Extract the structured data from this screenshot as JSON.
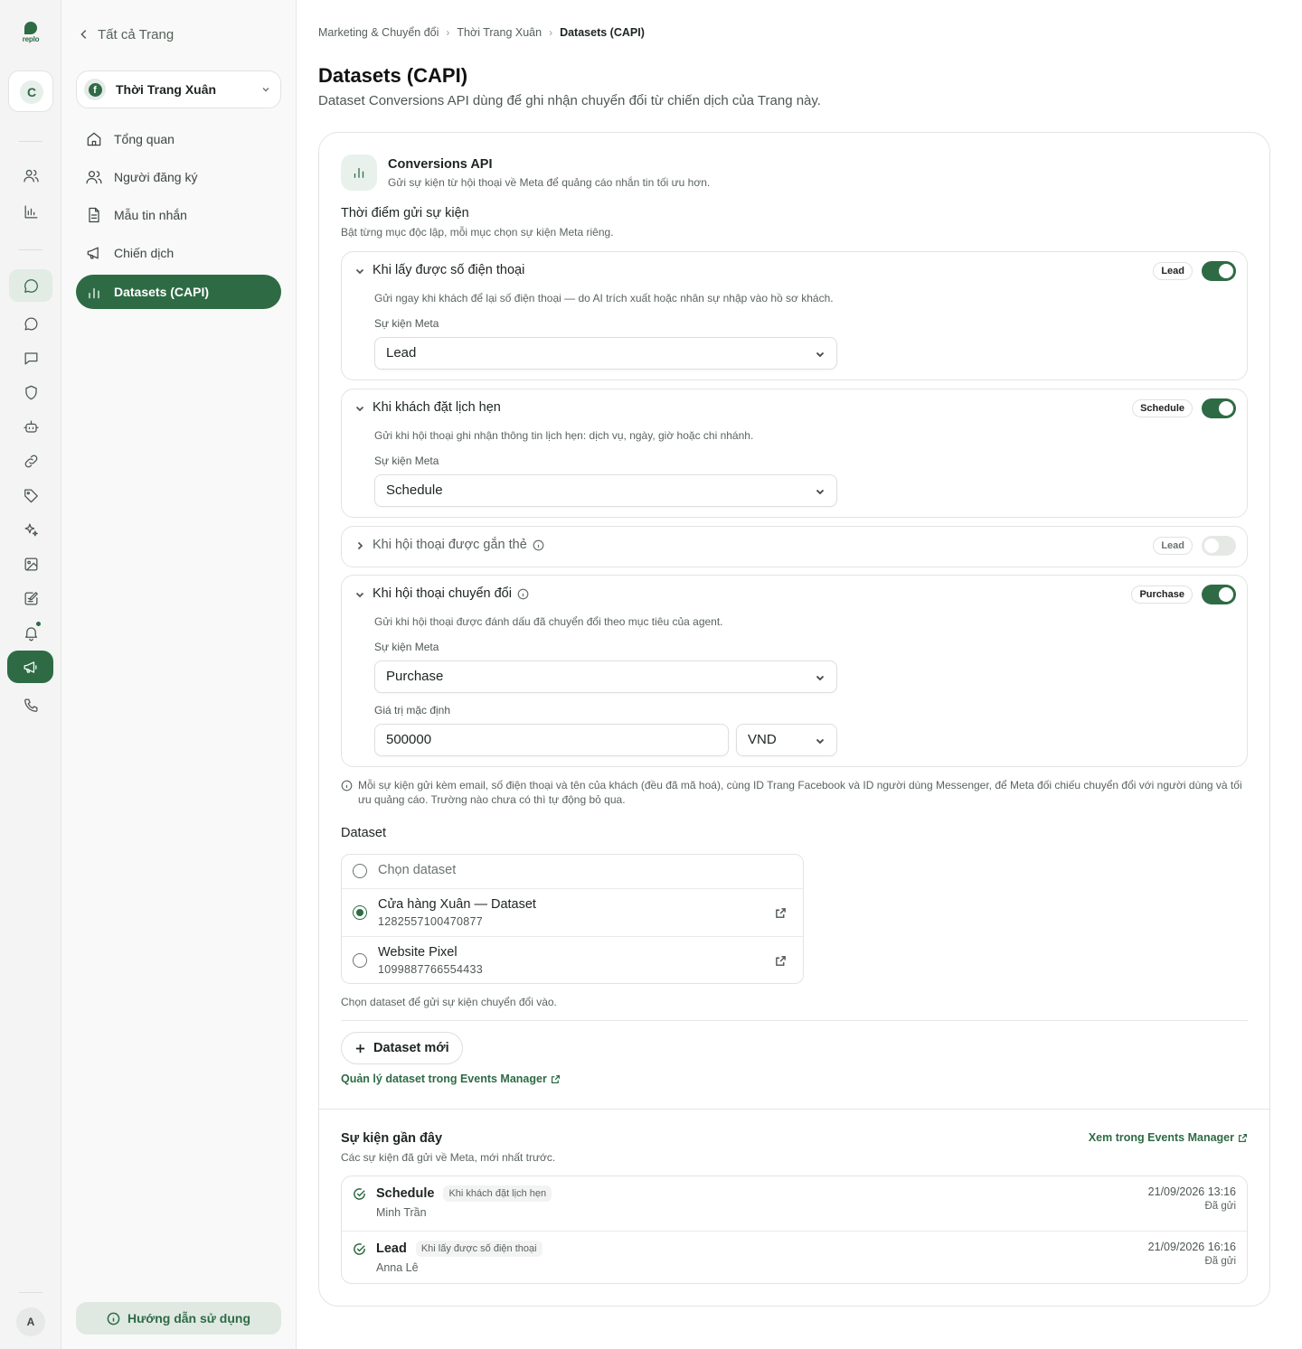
{
  "rail": {
    "logo_text": "replo",
    "workspace_initial": "C",
    "user_initial": "A",
    "accent": "#2e6b45",
    "icons": [
      "users-icon",
      "chart-icon",
      "chat-bubble-icon",
      "chat-icon",
      "message-square-icon",
      "shield-icon",
      "bot-icon",
      "link-icon",
      "tag-icon",
      "sparkles-icon",
      "image-icon",
      "edit-list-icon",
      "bell-icon",
      "megaphone-icon",
      "phone-icon"
    ]
  },
  "sidebar": {
    "back_label": "Tất cả Trang",
    "page_name": "Thời Trang Xuân",
    "items": [
      {
        "label": "Tổng quan",
        "icon": "home-icon"
      },
      {
        "label": "Người đăng ký",
        "icon": "users-icon"
      },
      {
        "label": "Mẫu tin nhắn",
        "icon": "file-text-icon"
      },
      {
        "label": "Chiến dịch",
        "icon": "megaphone-icon"
      },
      {
        "label": "Datasets (CAPI)",
        "icon": "bar-chart-icon",
        "active": true
      }
    ],
    "help_label": "Hướng dẫn sử dụng"
  },
  "breadcrumb": [
    "Marketing & Chuyển đổi",
    "Thời Trang Xuân",
    "Datasets (CAPI)"
  ],
  "page": {
    "title": "Datasets (CAPI)",
    "subtitle": "Dataset Conversions API dùng để ghi nhận chuyển đổi từ chiến dịch của Trang này."
  },
  "capi": {
    "title": "Conversions API",
    "subtitle": "Gửi sự kiện từ hội thoại về Meta để quảng cáo nhắn tin tối ưu hơn."
  },
  "timing": {
    "title": "Thời điểm gửi sự kiện",
    "subtitle": "Bật từng mục độc lập, mỗi mục chọn sự kiện Meta riêng.",
    "field_label": "Sự kiện Meta",
    "triggers": [
      {
        "title": "Khi lấy được số điện thoại",
        "badge": "Lead",
        "enabled": true,
        "expanded": true,
        "desc": "Gửi ngay khi khách để lại số điện thoại — do AI trích xuất hoặc nhân sự nhập vào hồ sơ khách.",
        "event": "Lead"
      },
      {
        "title": "Khi khách đặt lịch hẹn",
        "badge": "Schedule",
        "enabled": true,
        "expanded": true,
        "desc": "Gửi khi hội thoại ghi nhận thông tin lịch hẹn: dịch vụ, ngày, giờ hoặc chi nhánh.",
        "event": "Schedule"
      },
      {
        "title": "Khi hội thoại được gắn thẻ",
        "badge": "Lead",
        "enabled": false,
        "expanded": false
      },
      {
        "title": "Khi hội thoại chuyển đổi",
        "badge": "Purchase",
        "enabled": true,
        "expanded": true,
        "desc": "Gửi khi hội thoại được đánh dấu đã chuyển đổi theo mục tiêu của agent.",
        "event": "Purchase",
        "value_label": "Giá trị mặc định",
        "value": "500000",
        "currency": "VND"
      }
    ],
    "note": "Mỗi sự kiện gửi kèm email, số điện thoại và tên của khách (đều đã mã hoá), cùng ID Trang Facebook và ID người dùng Messenger, để Meta đối chiếu chuyển đổi với người dùng và tối ưu quảng cáo. Trường nào chưa có thì tự động bỏ qua."
  },
  "dataset": {
    "title": "Dataset",
    "placeholder": "Chọn dataset",
    "options": [
      {
        "name": "Cửa hàng Xuân — Dataset",
        "id": "1282557100470877",
        "selected": true
      },
      {
        "name": "Website Pixel",
        "id": "1099887766554433",
        "selected": false
      }
    ],
    "hint": "Chọn dataset để gửi sự kiện chuyển đổi vào.",
    "new_button": "Dataset mới",
    "manage_link": "Quản lý dataset trong Events Manager"
  },
  "recent": {
    "title": "Sự kiện gần đây",
    "subtitle": "Các sự kiện đã gửi về Meta, mới nhất trước.",
    "view_link": "Xem trong Events Manager",
    "events": [
      {
        "name": "Schedule",
        "trigger": "Khi khách đặt lịch hẹn",
        "user": "Minh Trần",
        "time": "21/09/2026 13:16",
        "status": "Đã gửi"
      },
      {
        "name": "Lead",
        "trigger": "Khi lấy được số điện thoại",
        "user": "Anna Lê",
        "time": "21/09/2026 16:16",
        "status": "Đã gửi"
      }
    ]
  }
}
